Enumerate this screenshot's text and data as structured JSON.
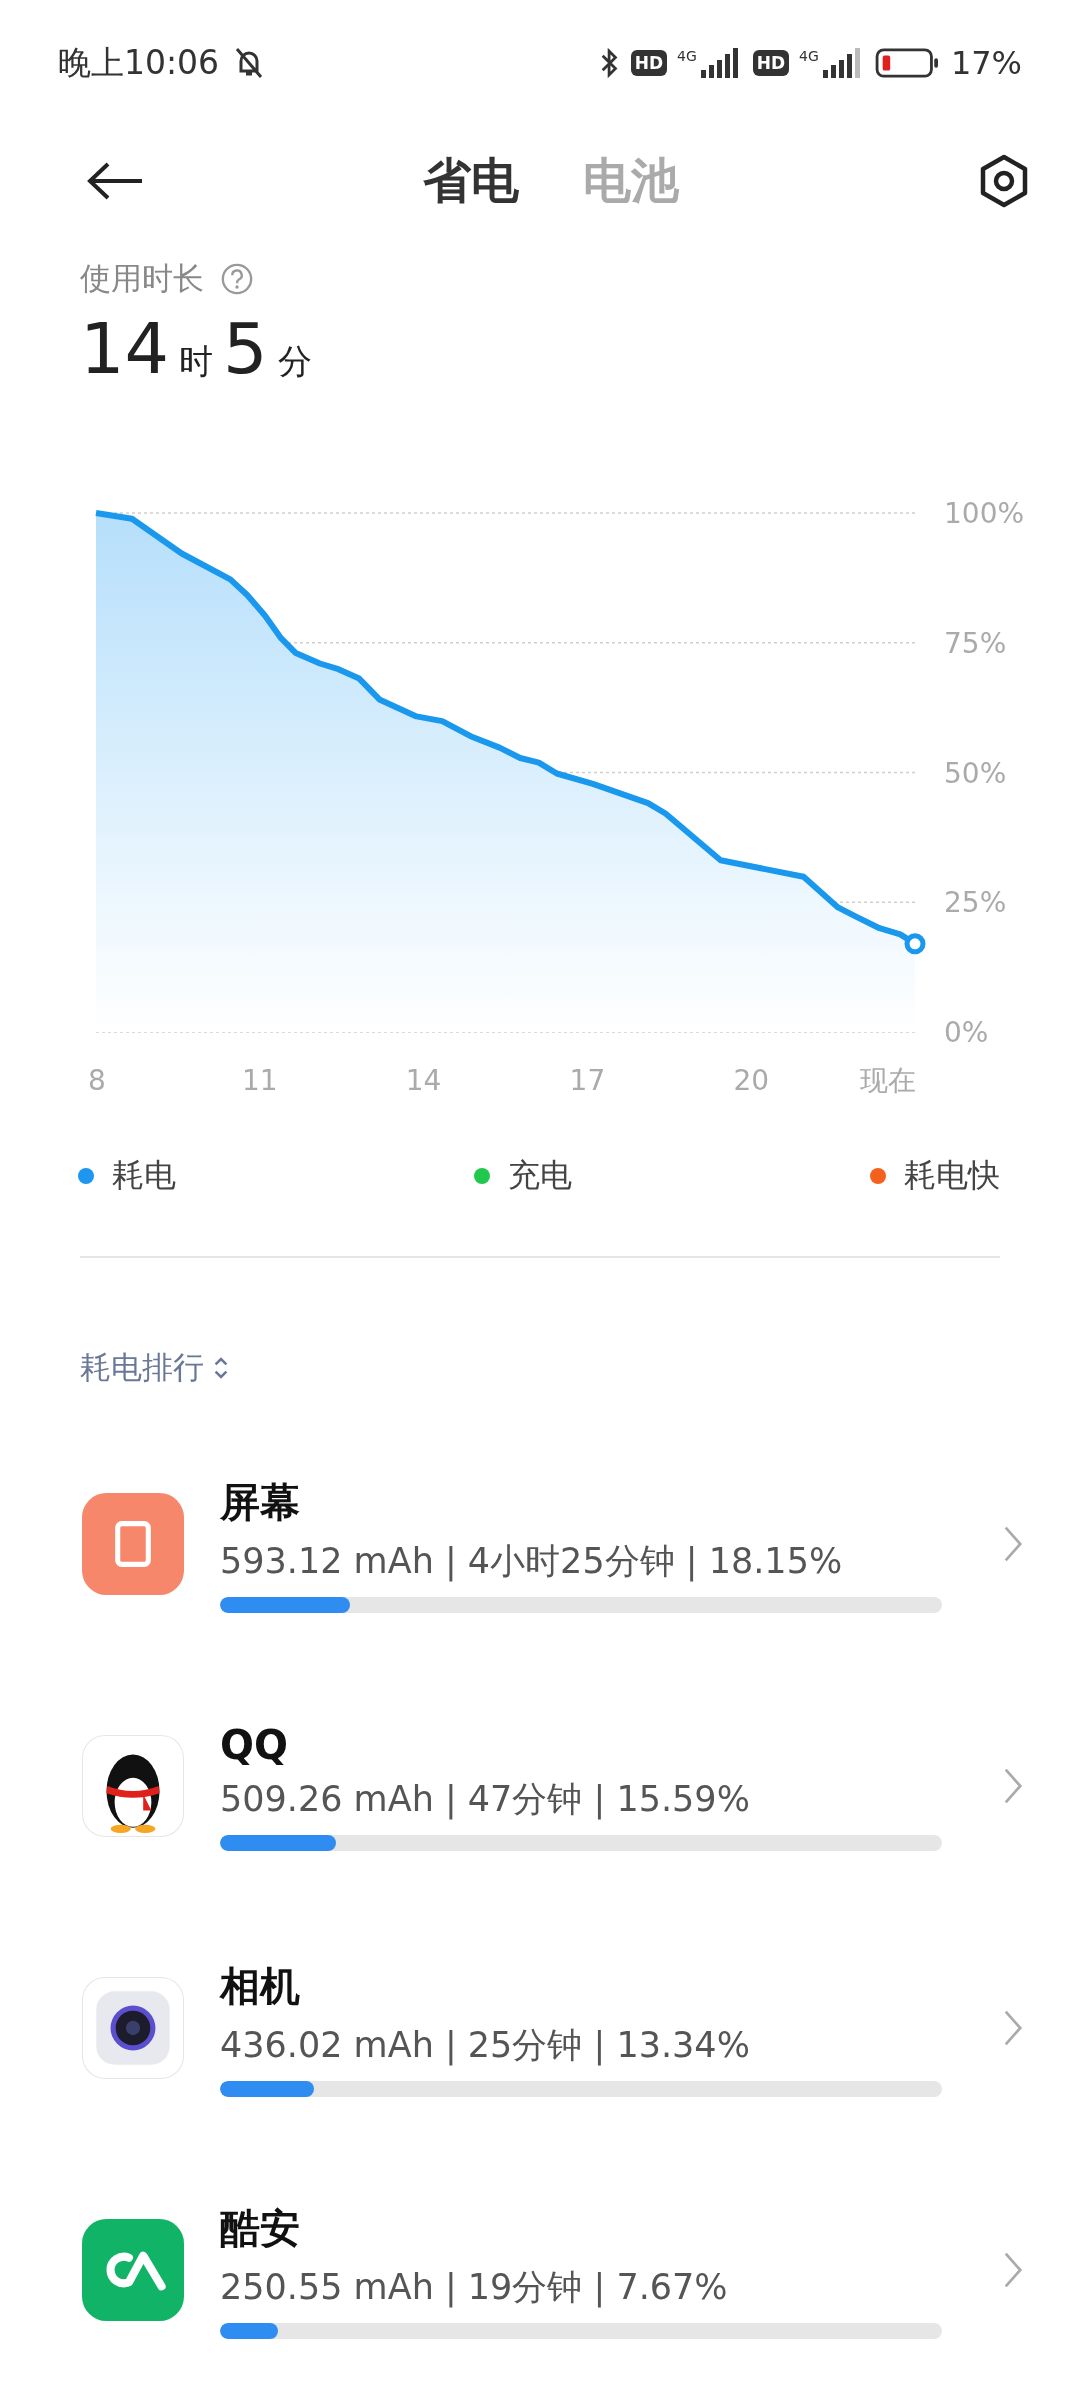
{
  "status_bar": {
    "time": "晚上10:06",
    "networks": [
      {
        "hd": "HD",
        "gen": "4G"
      },
      {
        "hd": "HD",
        "gen": "4G"
      }
    ],
    "battery_text": "17%"
  },
  "tabs": [
    {
      "label": "省电",
      "selected": true
    },
    {
      "label": "电池",
      "selected": false
    }
  ],
  "usage": {
    "label": "使用时长",
    "hours": "14",
    "hour_unit": "时",
    "minutes": "5",
    "minute_unit": "分"
  },
  "chart": {
    "chart_data": {
      "type": "area",
      "x": [
        8,
        8.66,
        9.57,
        10.46,
        10.77,
        11.09,
        11.38,
        11.66,
        12.1,
        12.44,
        12.82,
        13.2,
        13.87,
        14.34,
        14.86,
        15.39,
        15.77,
        16.11,
        16.44,
        17.1,
        18.11,
        18.43,
        19.44,
        20.96,
        21.59,
        21.91,
        22.35,
        22.73,
        23
      ],
      "grid": true,
      "series": [
        {
          "color": "#1a98ee",
          "values": [
            100,
            98.9,
            92.2,
            87.2,
            84.2,
            80.3,
            76,
            73,
            71,
            69.9,
            68.1,
            64,
            60.8,
            59.9,
            57,
            54.8,
            52.8,
            51.9,
            49.8,
            47.8,
            44.1,
            42.1,
            33.1,
            29.9,
            24,
            22.3,
            20,
            18.8,
            17
          ]
        }
      ],
      "xlim": [
        8,
        23
      ],
      "ylim": [
        0,
        100
      ],
      "xticks": [
        {
          "value": 8,
          "label": "8"
        },
        {
          "value": 11,
          "label": "11"
        },
        {
          "value": 14,
          "label": "14"
        },
        {
          "value": 17,
          "label": "17"
        },
        {
          "value": 20,
          "label": "20"
        },
        {
          "value": 22.5,
          "label": "现在"
        }
      ],
      "yticks": [
        {
          "value": 100,
          "label": "100%"
        },
        {
          "value": 75,
          "label": "75%"
        },
        {
          "value": 50,
          "label": "50%"
        },
        {
          "value": 25,
          "label": "25%"
        },
        {
          "value": 0,
          "label": "0%"
        }
      ]
    }
  },
  "legend": [
    {
      "label": "耗电",
      "color": "#1e96f0"
    },
    {
      "label": "充电",
      "color": "#22c74e"
    },
    {
      "label": "耗电快",
      "color": "#f4611e"
    }
  ],
  "ranking": {
    "title": "耗电排行",
    "items": [
      {
        "kind": "screen",
        "name": "屏幕",
        "detail": "593.12 mAh | 4小时25分钟 | 18.15%",
        "level": 0.18
      },
      {
        "kind": "penguin",
        "name": "QQ",
        "detail": "509.26 mAh | 47分钟 | 15.59%",
        "level": 0.16
      },
      {
        "kind": "camera",
        "name": "相机",
        "detail": "436.02 mAh | 25分钟 | 13.34%",
        "level": 0.13
      },
      {
        "kind": "loop",
        "name": "酷安",
        "detail": "250.55 mAh | 19分钟 | 7.67%",
        "level": 0.08
      }
    ]
  }
}
